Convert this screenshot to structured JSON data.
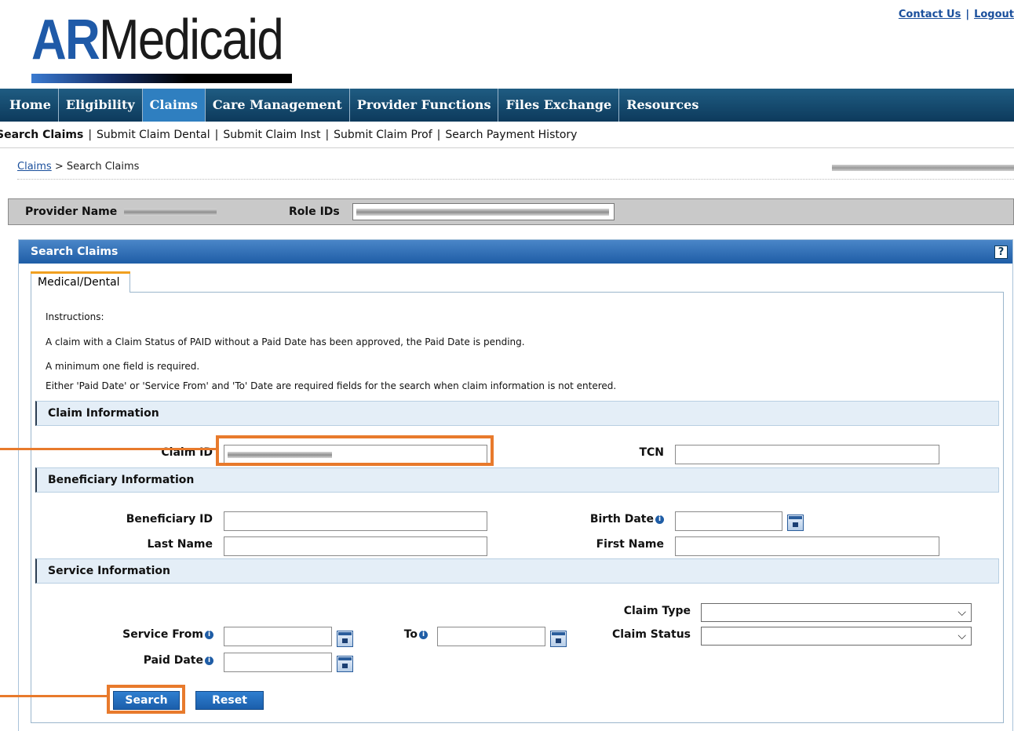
{
  "logo": {
    "ar": "AR",
    "medicaid": "Medicaid"
  },
  "top_links": {
    "contact": "Contact Us",
    "sep": "|",
    "logout": "Logout"
  },
  "nav": [
    {
      "label": "Home"
    },
    {
      "label": "Eligibility"
    },
    {
      "label": "Claims",
      "active": true
    },
    {
      "label": "Care Management"
    },
    {
      "label": "Provider Functions"
    },
    {
      "label": "Files Exchange"
    },
    {
      "label": "Resources"
    }
  ],
  "subnav": {
    "items": [
      "Search Claims",
      "Submit Claim Dental",
      "Submit Claim Inst",
      "Submit Claim Prof",
      "Search Payment History"
    ],
    "separator": "|"
  },
  "breadcrumb": {
    "parent": "Claims",
    "separator": ">",
    "current": "Search Claims"
  },
  "provider_bar": {
    "provider_name_label": "Provider Name",
    "role_ids_label": "Role IDs"
  },
  "panel": {
    "title": "Search Claims",
    "help": "?",
    "tab": "Medical/Dental",
    "instructions": {
      "heading": "Instructions:",
      "line1": "A claim with a Claim Status of PAID without a Paid Date has been approved, the Paid Date is pending.",
      "line2": "A minimum one field is required.",
      "line3": "Either 'Paid Date' or 'Service From' and 'To' Date are required fields for the search when claim information is not entered."
    },
    "claim_info": {
      "title": "Claim Information",
      "claim_id_label": "Claim ID",
      "tcn_label": "TCN"
    },
    "beneficiary_info": {
      "title": "Beneficiary Information",
      "beneficiary_id_label": "Beneficiary ID",
      "birth_date_label": "Birth Date",
      "last_name_label": "Last Name",
      "first_name_label": "First Name"
    },
    "service_info": {
      "title": "Service Information",
      "claim_type_label": "Claim Type",
      "service_from_label": "Service From",
      "to_label": "To",
      "claim_status_label": "Claim Status",
      "paid_date_label": "Paid Date"
    },
    "buttons": {
      "search": "Search",
      "reset": "Reset"
    }
  },
  "colors": {
    "nav_bg": "#0d3a5c",
    "nav_active": "#2f7fc0",
    "panel_header": "#1f5da6",
    "highlight": "#e87a2c",
    "section_bg": "#e4eef7"
  },
  "icons": {
    "help": "help-icon",
    "info": "info-icon",
    "calendar": "calendar-icon",
    "dropdown": "chevron-down-icon"
  }
}
